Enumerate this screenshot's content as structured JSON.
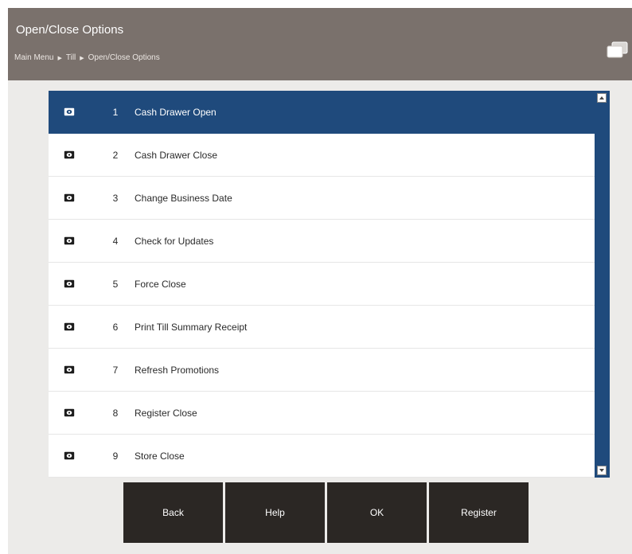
{
  "header": {
    "title": "Open/Close Options",
    "breadcrumb": [
      "Main Menu",
      "Till",
      "Open/Close Options"
    ]
  },
  "icons": {
    "row_icon": "cash-drawer-icon",
    "window_icon": "window-stack-icon",
    "breadcrumb_separator": "triangle-right-icon"
  },
  "colors": {
    "header_bg": "#7a716c",
    "selected_row_bg": "#1f4a7c",
    "scrollbar_bg": "#1f4a7c",
    "button_bg": "#2b2724"
  },
  "menu": {
    "selected_index": 0,
    "items": [
      {
        "number": "1",
        "label": "Cash Drawer Open"
      },
      {
        "number": "2",
        "label": "Cash Drawer Close"
      },
      {
        "number": "3",
        "label": "Change Business Date"
      },
      {
        "number": "4",
        "label": "Check for Updates"
      },
      {
        "number": "5",
        "label": "Force Close"
      },
      {
        "number": "6",
        "label": "Print Till Summary Receipt"
      },
      {
        "number": "7",
        "label": "Refresh Promotions"
      },
      {
        "number": "8",
        "label": "Register Close"
      },
      {
        "number": "9",
        "label": "Store Close"
      }
    ]
  },
  "buttons": {
    "back": "Back",
    "help": "Help",
    "ok": "OK",
    "register": "Register"
  }
}
